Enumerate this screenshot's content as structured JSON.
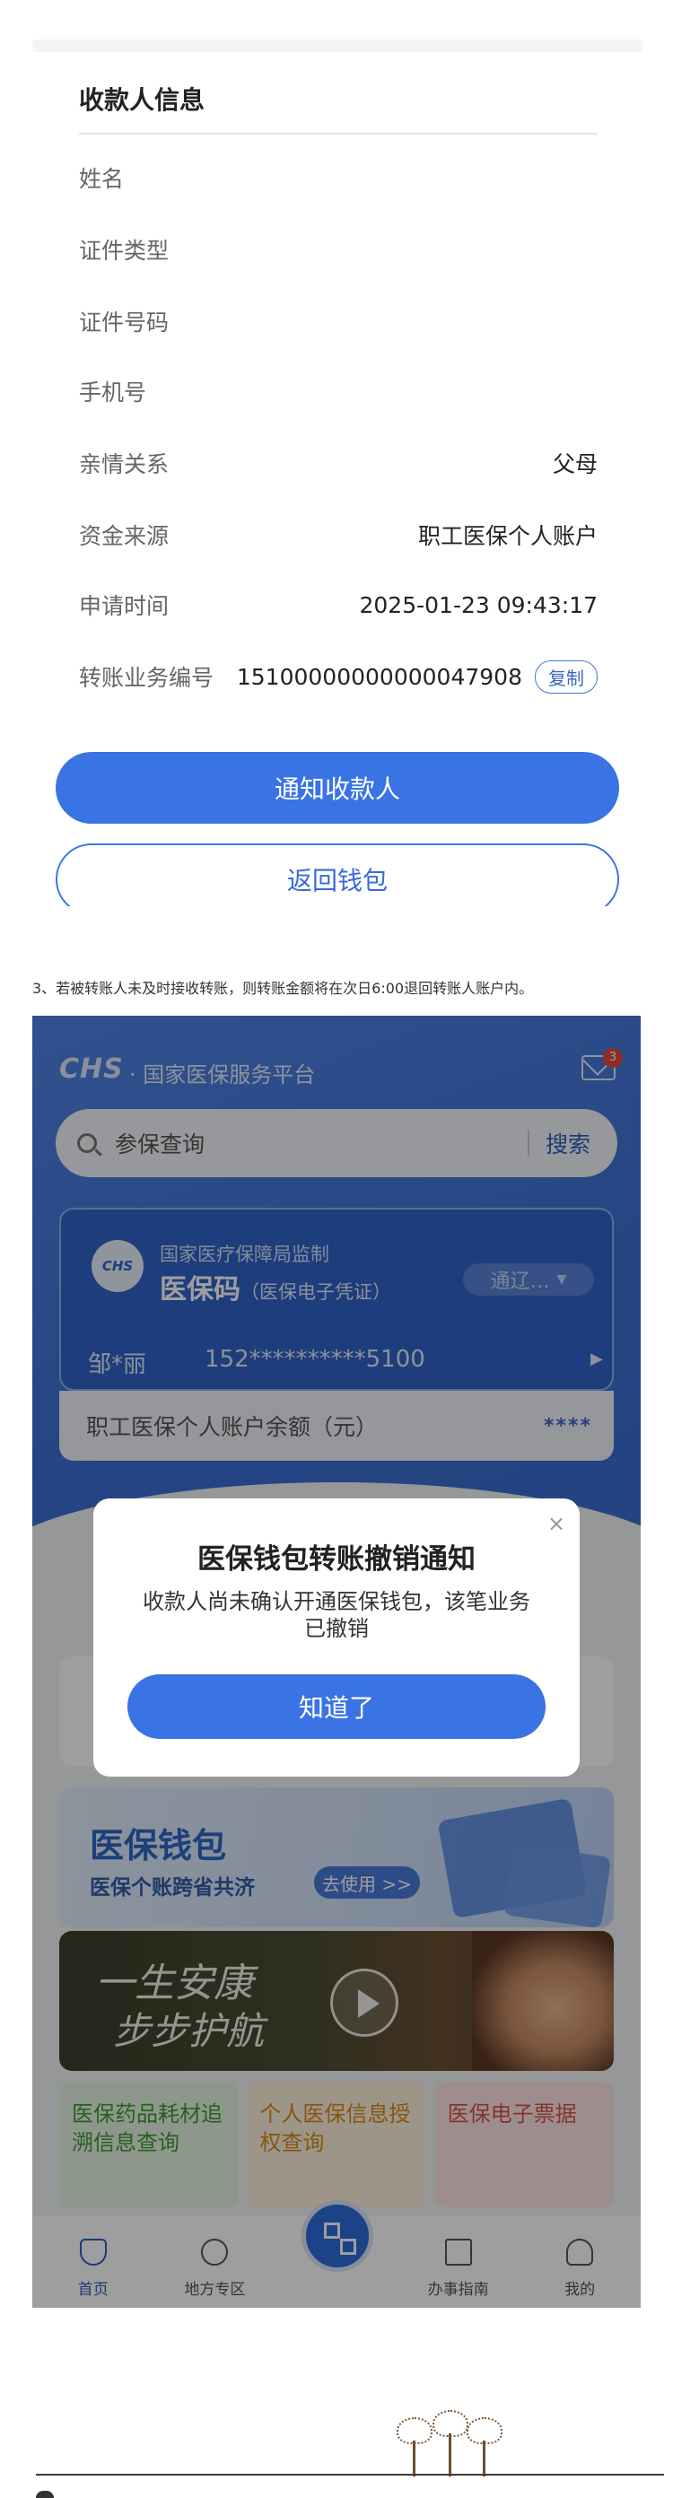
{
  "payee": {
    "title": "收款人信息",
    "rows": [
      {
        "label": "姓名",
        "value": ""
      },
      {
        "label": "证件类型",
        "value": ""
      },
      {
        "label": "证件号码",
        "value": ""
      },
      {
        "label": "手机号",
        "value": ""
      },
      {
        "label": "亲情关系",
        "value": "父母"
      },
      {
        "label": "资金来源",
        "value": "职工医保个人账户"
      },
      {
        "label": "申请时间",
        "value": "2025-01-23 09:43:17"
      },
      {
        "label": "转账业务编号",
        "value": "15100000000000047908"
      }
    ],
    "copy_label": "复制",
    "notify_button": "通知收款人",
    "back_button": "返回钱包"
  },
  "note": "3、若被转账人未及时接收转账，则转账金额将在次日6:00退回转账人账户内。",
  "app": {
    "logo_text": "CHS",
    "brand": "· 国家医保服务平台",
    "mail_badge": "3",
    "search_placeholder": "参保查询",
    "search_button": "搜索",
    "card": {
      "logo": "CHS",
      "supervisor": "国家医疗保障局监制",
      "title": "医保码",
      "subtitle": "（医保电子凭证）",
      "region": "通辽…",
      "holder": "邹*丽",
      "phone": "152**********5100"
    },
    "balance_label": "职工医保个人账户余额（元）",
    "balance_value": "****",
    "wallet": {
      "title": "医保钱包",
      "subtitle": "医保个账跨省共济",
      "go": "去使用 >>"
    },
    "video": {
      "line1": "一生安康",
      "line2": "步步护航"
    },
    "tiles": [
      {
        "label": "医保药品耗材追溯信息查询"
      },
      {
        "label": "个人医保信息授权查询"
      },
      {
        "label": "医保电子票据"
      }
    ],
    "tabs": [
      {
        "label": "首页"
      },
      {
        "label": "地方专区"
      },
      {
        "label": ""
      },
      {
        "label": "办事指南"
      },
      {
        "label": "我的"
      }
    ],
    "modal": {
      "title": "医保钱包转账撤销通知",
      "body": "收款人尚未确认开通医保钱包，该笔业务已撤销",
      "button": "知道了"
    }
  },
  "colors": {
    "primary": "#3a74e4",
    "hero_blue": "#4f84e6",
    "badge_red": "#e4493f"
  }
}
